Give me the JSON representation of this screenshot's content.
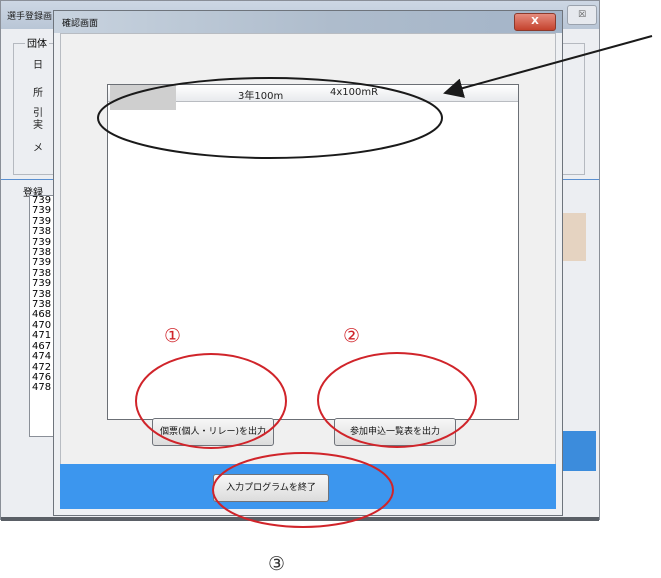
{
  "background_window": {
    "title": "選手登録画",
    "close_label": "☒",
    "group_title": "団体",
    "field_labels": [
      "日",
      "所",
      "引",
      "実",
      "メ"
    ],
    "list_title": "登録",
    "list_items": [
      "739",
      "739",
      "739",
      "738",
      "739",
      "738",
      "739",
      "738",
      "739",
      "738",
      "738",
      "468",
      "470",
      "471",
      "467",
      "474",
      "472",
      "476",
      "478"
    ]
  },
  "dialog": {
    "title": "確認画面",
    "close_label": "X",
    "list_columns": [
      "3年100m",
      "4x100mR"
    ],
    "buttons": {
      "entry_card": "個票(個人・リレー)を出力",
      "entry_list": "参加申込一覧表を出力",
      "exit": "入力プログラムを終了"
    }
  },
  "annotations": {
    "labels": [
      "①",
      "②",
      "③"
    ],
    "colors": {
      "ellipse_black": "#1a1a1a",
      "ellipse_red": "#d0242a",
      "arrow": "#1a1a1a"
    }
  },
  "colors": {
    "accent_blue": "#3c96ee"
  }
}
